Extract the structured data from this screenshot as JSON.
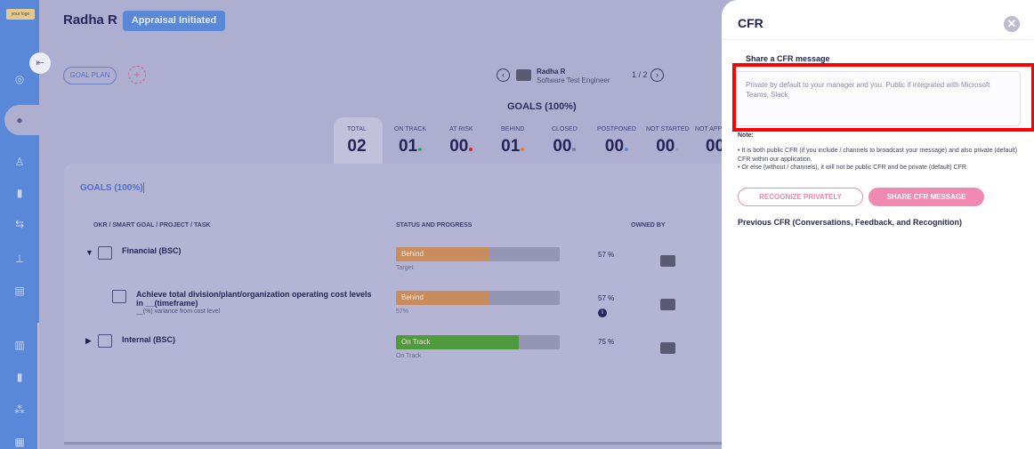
{
  "sidebar": {
    "logo_text": "your logo",
    "toggle_icon": "collapse-sidebar-icon",
    "items": [
      {
        "icon": "goal-target-icon"
      },
      {
        "icon": "team-icon"
      },
      {
        "icon": "person-icon"
      },
      {
        "icon": "card-icon"
      },
      {
        "icon": "handshake-icon"
      },
      {
        "icon": "org-chart-icon"
      },
      {
        "icon": "document-edit-icon"
      },
      {
        "icon": "report-chart-icon"
      },
      {
        "icon": "card2-icon"
      },
      {
        "icon": "group-icon"
      },
      {
        "icon": "analytics-icon"
      }
    ]
  },
  "header": {
    "user_name": "Radha R",
    "appraisal_status": "Appraisal Initiated",
    "goal_plan_label": "GOAL PLAN"
  },
  "employee_nav": {
    "name": "Radha R",
    "role": "Software Test Engineer",
    "pager": "1 / 2",
    "prev_symbol": "‹",
    "next_symbol": "›"
  },
  "goals_summary": {
    "title": "GOALS (100%)",
    "stats": [
      {
        "label": "TOTAL",
        "value": "02"
      },
      {
        "label": "ON TRACK",
        "value": "01",
        "dot_color": "#33a86a"
      },
      {
        "label": "AT RISK",
        "value": "00",
        "dot_color": "#e02828"
      },
      {
        "label": "BEHIND",
        "value": "01",
        "dot_color": "#e08a2c"
      },
      {
        "label": "CLOSED",
        "value": "00",
        "dot_color": "#7c7ca0"
      },
      {
        "label": "POSTPONED",
        "value": "00",
        "dot_color": "#5a8ad8"
      },
      {
        "label": "NOT STARTED",
        "value": "00",
        "dot_color": "#a0a0b8"
      },
      {
        "label": "NOT APP",
        "value": "00"
      }
    ]
  },
  "goals_table": {
    "tab_label": "GOALS (100%)",
    "columns": [
      "OKR / SMART GOAL / PROJECT / TASK",
      "STATUS AND PROGRESS",
      "OWNED BY"
    ],
    "rows": [
      {
        "caret": "▼",
        "title": "Financial (BSC)",
        "subtitle": "",
        "status": "Behind",
        "status_color": "#c98c5c",
        "progress": 0.57,
        "caption": "Target",
        "percent": "57 %"
      },
      {
        "caret": "",
        "title": "Achieve total division/plant/organization operating cost levels in __(timeframe)",
        "subtitle": "__(%) variance from cost level",
        "status": "Behind",
        "status_color": "#c98c5c",
        "progress": 0.57,
        "caption": "57%",
        "percent": "57 %",
        "info_icon": "i"
      },
      {
        "caret": "▶",
        "title": "Internal (BSC)",
        "subtitle": "",
        "status": "On Track",
        "status_color": "#4e9a3c",
        "progress": 0.75,
        "caption": "On Track",
        "percent": "75 %"
      }
    ]
  },
  "cfr_panel": {
    "title": "CFR",
    "close_symbol": "✕",
    "share_label": "Share a CFR message",
    "placeholder": "Private by default to your manager and you. Public if integrated with Microsoft Teams, Slack",
    "note_title": "Note:",
    "notes": [
      "• It is both public CFR (if you include / channels to broadcast your message) and also private (default) CFR within our application.",
      "• Or else (without / channels), it will not be public CFR and be private (default) CFR."
    ],
    "recognize_label": "RECOGNIZE PRIVATELY",
    "share_button_label": "SHARE CFR MESSAGE",
    "previous_label": "Previous CFR (Conversations, Feedback, and Recognition)"
  }
}
